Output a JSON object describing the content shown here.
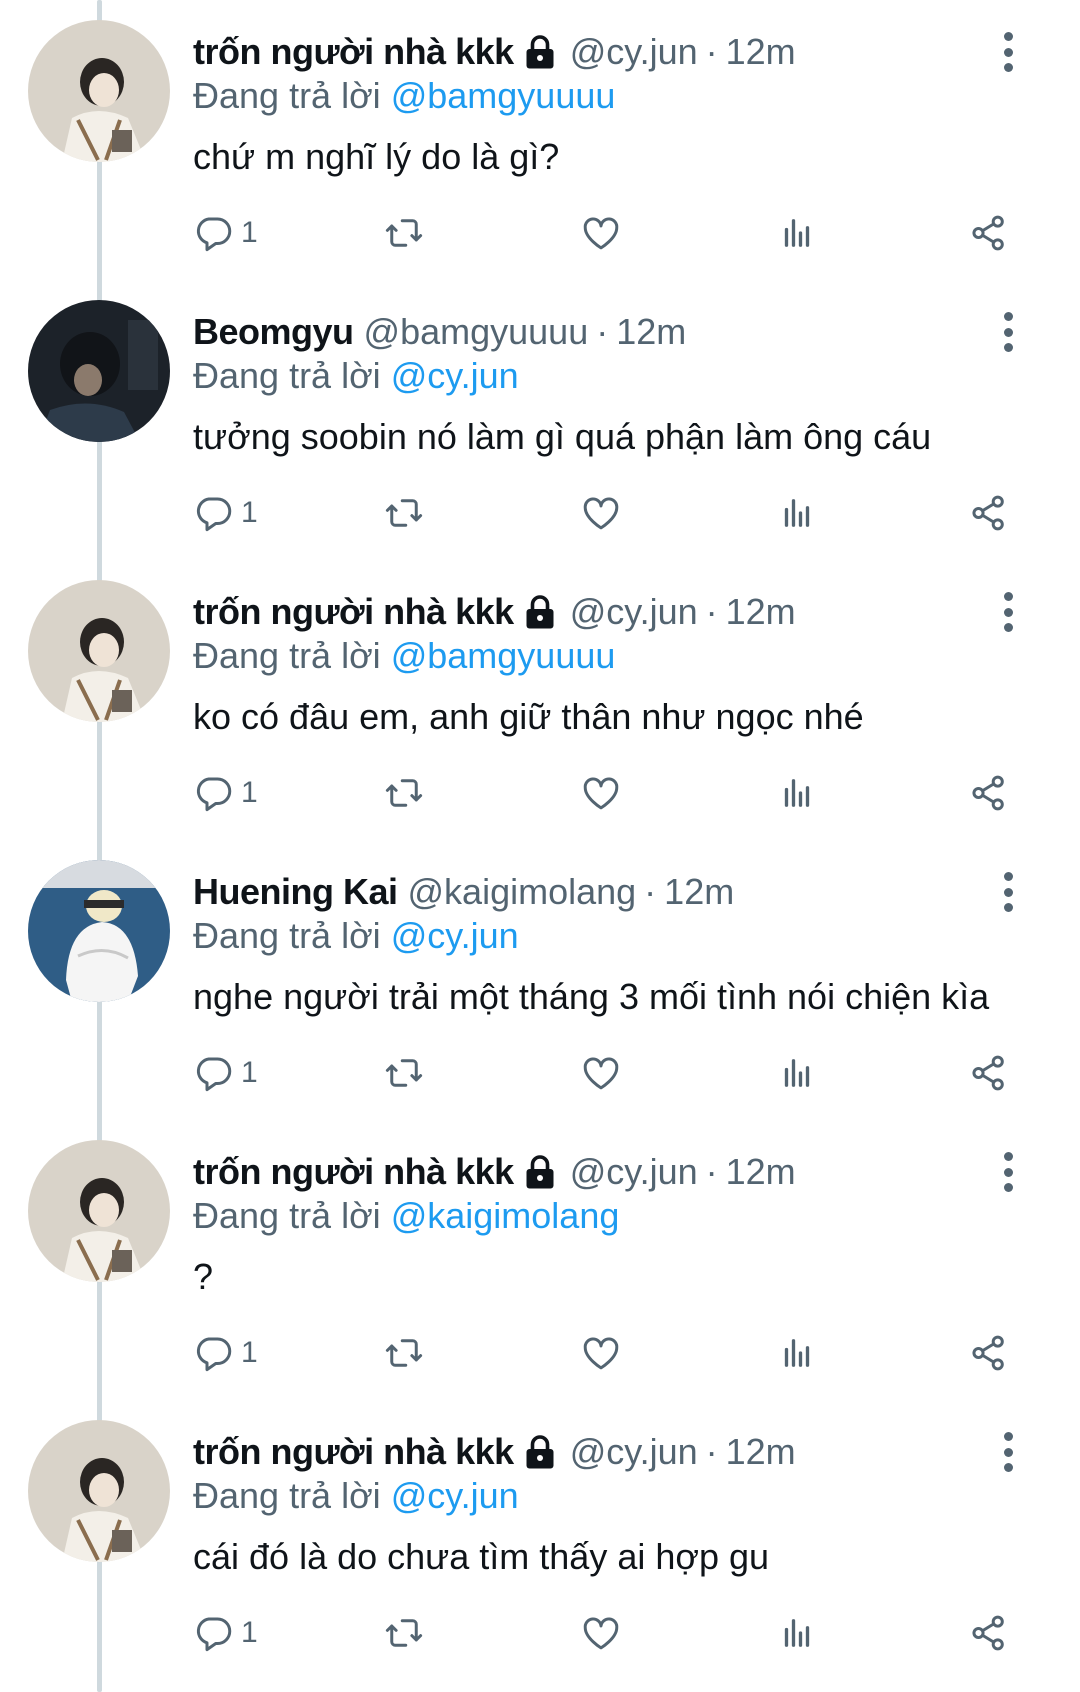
{
  "colors": {
    "text_primary": "#0f1419",
    "text_secondary": "#536471",
    "link": "#1d9bf0",
    "thread_line": "#cfd9de"
  },
  "icons": {
    "reply": "reply-icon",
    "retweet": "retweet-icon",
    "like": "heart-icon",
    "views": "analytics-icon",
    "share": "share-icon",
    "more": "more-dots-icon",
    "protected": "lock-icon"
  },
  "tweets": [
    {
      "name": "trốn người nhà kkk",
      "protected": true,
      "handle": "@cy.jun",
      "separator": "·",
      "time": "12m",
      "reply_prefix": "Đang trả lời",
      "reply_to": "@bamgyuuuu",
      "text": "chứ m nghĩ lý do là gì?",
      "reply_count": "1"
    },
    {
      "name": "Beomgyu",
      "protected": false,
      "handle": "@bamgyuuuu",
      "separator": "·",
      "time": "12m",
      "reply_prefix": "Đang trả lời",
      "reply_to": "@cy.jun",
      "text": "tưởng soobin nó làm gì quá phận làm ông cáu",
      "reply_count": "1"
    },
    {
      "name": "trốn người nhà kkk",
      "protected": true,
      "handle": "@cy.jun",
      "separator": "·",
      "time": "12m",
      "reply_prefix": "Đang trả lời",
      "reply_to": "@bamgyuuuu",
      "text": "ko có đâu em, anh giữ thân như ngọc nhé",
      "reply_count": "1"
    },
    {
      "name": "Huening Kai",
      "protected": false,
      "handle": "@kaigimolang",
      "separator": "·",
      "time": "12m",
      "reply_prefix": "Đang trả lời",
      "reply_to": "@cy.jun",
      "text": "nghe người trải một tháng 3 mối tình nói chiện kìa",
      "reply_count": "1"
    },
    {
      "name": "trốn người nhà kkk",
      "protected": true,
      "handle": "@cy.jun",
      "separator": "·",
      "time": "12m",
      "reply_prefix": "Đang trả lời",
      "reply_to": "@kaigimolang",
      "text": "?",
      "reply_count": "1"
    },
    {
      "name": "trốn người nhà kkk",
      "protected": true,
      "handle": "@cy.jun",
      "separator": "·",
      "time": "12m",
      "reply_prefix": "Đang trả lời",
      "reply_to": "@cy.jun",
      "text": "cái đó là do chưa tìm thấy ai hợp gu",
      "reply_count": "1"
    }
  ]
}
